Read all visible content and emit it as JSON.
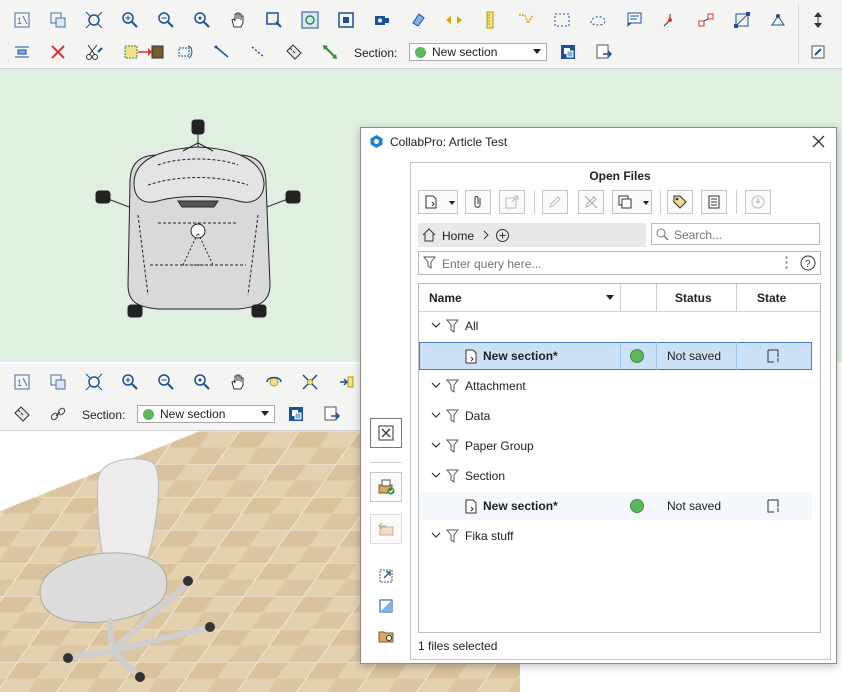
{
  "toolbar_top": {
    "section_label": "Section:",
    "section_value": "New section"
  },
  "toolbar_3d": {
    "section_label": "Section:",
    "section_value": "New section"
  },
  "colors": {
    "plan_bg": "#e1efe3",
    "status_green": "#5cb85c",
    "selection": "#cce1f7",
    "selection_border": "#3f7fcf"
  },
  "panel": {
    "title": "CollabPro: Article Test",
    "header": "Open Files",
    "breadcrumb_home": "Home",
    "search_placeholder": "Search...",
    "query_placeholder": "Enter query here...",
    "columns": {
      "name": "Name",
      "status": "Status",
      "state": "State"
    },
    "rows": [
      {
        "type": "group",
        "label": "All"
      },
      {
        "type": "file",
        "label": "New section*",
        "status": "Not saved",
        "selected": true
      },
      {
        "type": "group",
        "label": "Attachment"
      },
      {
        "type": "group",
        "label": "Data"
      },
      {
        "type": "group",
        "label": "Paper Group"
      },
      {
        "type": "group",
        "label": "Section"
      },
      {
        "type": "file",
        "label": "New section*",
        "status": "Not saved",
        "selected": false
      },
      {
        "type": "group",
        "label": "Fika stuff"
      }
    ],
    "footer": "1 files selected"
  }
}
